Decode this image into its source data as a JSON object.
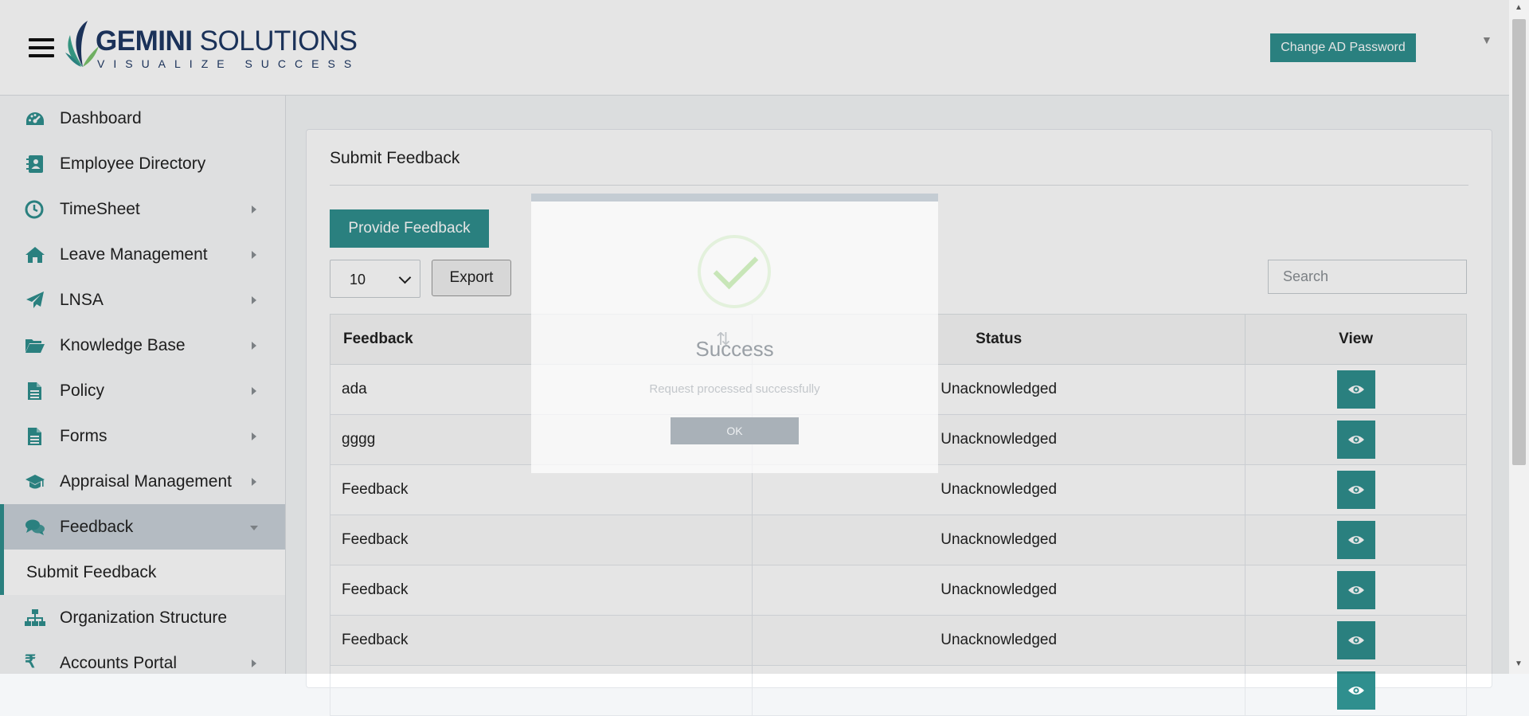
{
  "header": {
    "logo_name_bold": "GEMINI",
    "logo_name_rest": " SOLUTIONS",
    "logo_tagline": "VISUALIZE SUCCESS",
    "change_password_label": "Change AD Password",
    "user_menu_icon": "caret-down-icon"
  },
  "sidebar": {
    "items": [
      {
        "label": "Dashboard",
        "icon": "dashboard-gauge-icon",
        "has_children": false
      },
      {
        "label": "Employee Directory",
        "icon": "contact-book-icon",
        "has_children": false
      },
      {
        "label": "TimeSheet",
        "icon": "clock-icon",
        "has_children": true
      },
      {
        "label": "Leave Management",
        "icon": "home-icon",
        "has_children": true
      },
      {
        "label": "LNSA",
        "icon": "paper-plane-icon",
        "has_children": true
      },
      {
        "label": "Knowledge Base",
        "icon": "folder-open-icon",
        "has_children": true
      },
      {
        "label": "Policy",
        "icon": "document-icon",
        "has_children": true
      },
      {
        "label": "Forms",
        "icon": "document-icon",
        "has_children": true
      },
      {
        "label": "Appraisal Management",
        "icon": "graduation-cap-icon",
        "has_children": true
      },
      {
        "label": "Feedback",
        "icon": "chat-bubbles-icon",
        "has_children": true,
        "expanded": true
      },
      {
        "label": "Submit Feedback",
        "submenu": true
      },
      {
        "label": "Organization Structure",
        "icon": "org-chart-icon",
        "has_children": false
      },
      {
        "label": "Accounts Portal",
        "icon": "rupee-icon",
        "has_children": true
      }
    ]
  },
  "main": {
    "title": "Submit Feedback",
    "provide_feedback_label": "Provide Feedback",
    "page_size": "10",
    "export_label": "Export",
    "search_placeholder": "Search",
    "table": {
      "columns": [
        "Feedback",
        "Status",
        "View"
      ],
      "rows": [
        {
          "feedback": "ada",
          "status": "Unacknowledged"
        },
        {
          "feedback": "gggg",
          "status": "Unacknowledged"
        },
        {
          "feedback": "Feedback",
          "status": "Unacknowledged"
        },
        {
          "feedback": "Feedback",
          "status": "Unacknowledged"
        },
        {
          "feedback": "Feedback",
          "status": "Unacknowledged"
        },
        {
          "feedback": "Feedback",
          "status": "Unacknowledged"
        },
        {
          "feedback": "",
          "status": ""
        }
      ]
    }
  },
  "modal": {
    "title": "Success",
    "message": "Request processed successfully",
    "ok_label": "OK",
    "icon": "checkmark-icon"
  },
  "colors": {
    "accent": "#2f8f8e",
    "logo_text": "#1f3864"
  }
}
